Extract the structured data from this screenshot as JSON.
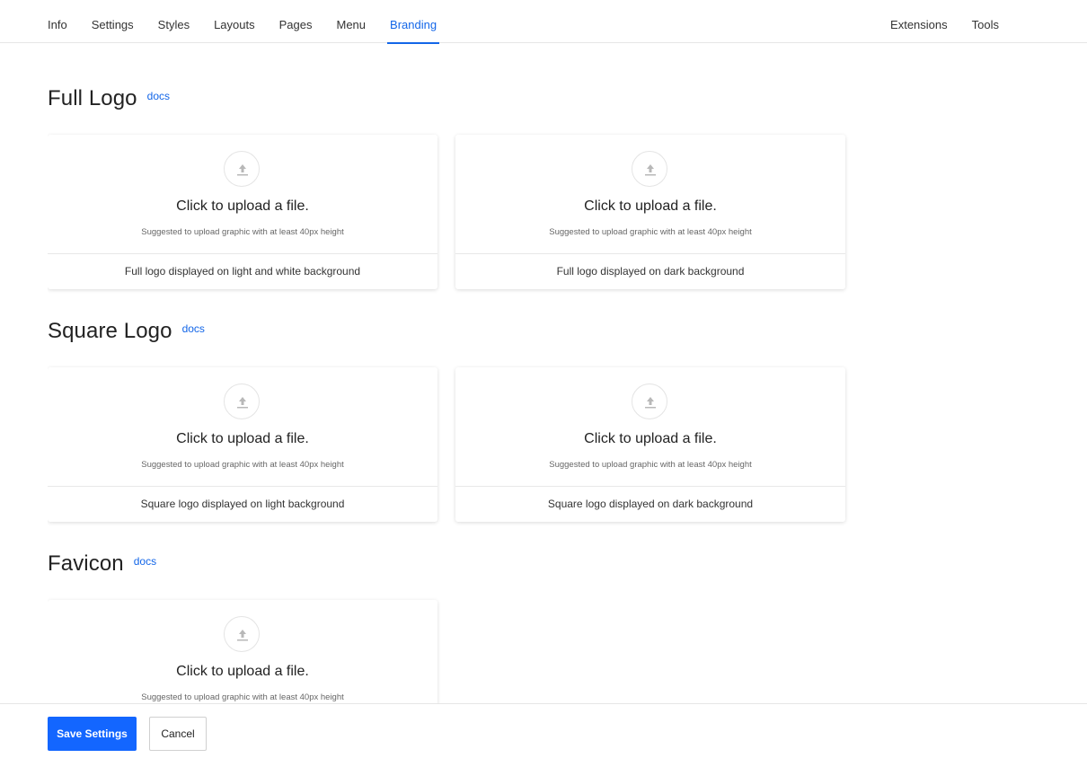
{
  "nav": {
    "left": [
      "Info",
      "Settings",
      "Styles",
      "Layouts",
      "Pages",
      "Menu",
      "Branding"
    ],
    "right": [
      "Extensions",
      "Tools"
    ],
    "active": "Branding"
  },
  "upload": {
    "title": "Click to upload a file.",
    "hint": "Suggested to upload graphic with at least 40px height",
    "icon": "upload-arrow-icon"
  },
  "sections": [
    {
      "title": "Full Logo",
      "docs": "docs",
      "cards": [
        {
          "caption": "Full logo displayed on light and white background"
        },
        {
          "caption": "Full logo displayed on dark background"
        }
      ]
    },
    {
      "title": "Square Logo",
      "docs": "docs",
      "cards": [
        {
          "caption": "Square logo displayed on light background"
        },
        {
          "caption": "Square logo displayed on dark background"
        }
      ]
    },
    {
      "title": "Favicon",
      "docs": "docs",
      "cards": [
        {
          "caption": ""
        }
      ]
    }
  ],
  "footer": {
    "save_label": "Save Settings",
    "cancel_label": "Cancel"
  },
  "colors": {
    "accent": "#1366e8",
    "primary_button": "#1366ff"
  }
}
